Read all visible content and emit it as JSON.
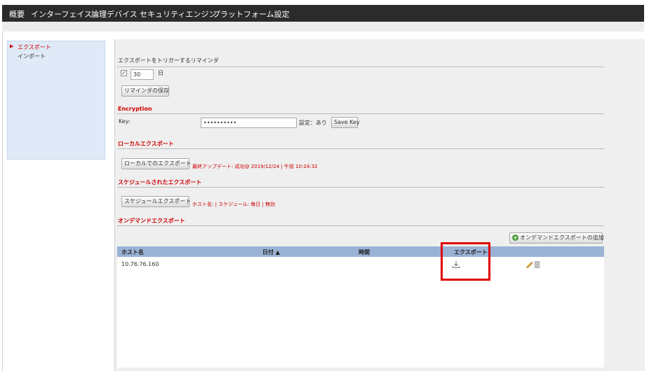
{
  "nav": {
    "items": [
      "概要",
      "インターフェイス",
      "論理デバイス",
      "セキュリティエンジン",
      "プラットフォーム設定"
    ]
  },
  "sidebar": {
    "items": [
      {
        "label": "エクスポート",
        "active": true
      },
      {
        "label": "インポート",
        "active": false
      }
    ]
  },
  "reminder": {
    "title": "エクスポートをトリガーするリマインダ",
    "checkbox_mark": "✓",
    "days_value": "30",
    "days_unit": "日",
    "save_button": "リマインダの保存"
  },
  "encryption": {
    "title": "Encryption",
    "key_label": "Key:",
    "key_value": "••••••••••",
    "status": "設定：あり",
    "save_button": "Save Key"
  },
  "local_export": {
    "title": "ローカルエクスポート",
    "button": "ローカルでのエクスポート",
    "status": "最終アップデート: 成功@ 2019/12/24 | 午前 10:24:32"
  },
  "scheduled_export": {
    "title": "スケジュールされたエクスポート",
    "button": "スケジュールエクスポート",
    "status": "ホスト名: | スケジュール: 毎日 | 無効"
  },
  "on_demand": {
    "title": "オンデマンドエクスポート",
    "add_button": "オンデマンドエクスポートの追加",
    "columns": {
      "host": "ホスト名",
      "date": "日付 ▲",
      "time": "時間",
      "export": "エクスポート"
    },
    "rows": [
      {
        "host": "10.76.76.160",
        "date": "",
        "time": ""
      }
    ]
  },
  "colors": {
    "accent_red": "#cc0000",
    "table_header": "#9ab3d5",
    "sidebar_bg": "#dfe9f7",
    "topbar": "#2b2b2b"
  }
}
